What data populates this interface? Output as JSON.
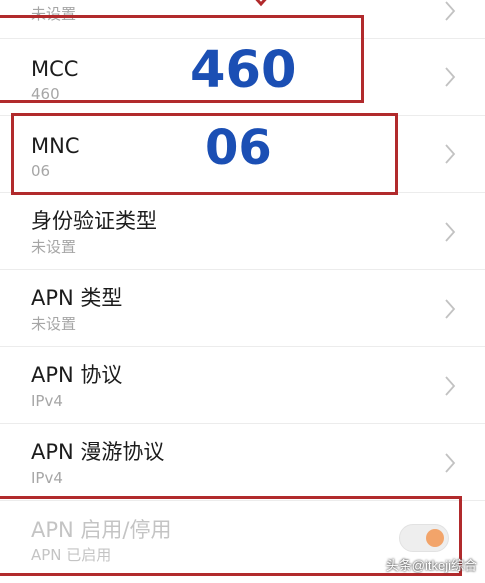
{
  "rows": [
    {
      "title": "",
      "subtitle": "未设置"
    },
    {
      "title": "MCC",
      "subtitle": "460"
    },
    {
      "title": "MNC",
      "subtitle": "06"
    },
    {
      "title": "身份验证类型",
      "subtitle": "未设置"
    },
    {
      "title": "APN 类型",
      "subtitle": "未设置"
    },
    {
      "title": "APN 协议",
      "subtitle": "IPv4"
    },
    {
      "title": "APN 漫游协议",
      "subtitle": "IPv4"
    },
    {
      "title": "APN 启用/停用",
      "subtitle": "APN 已启用"
    }
  ],
  "annotations": {
    "mcc_value": "460",
    "mnc_value": "06"
  },
  "toggle": {
    "apn_enabled": true
  },
  "icons": {
    "row_chevron": "chevron-right-icon",
    "top_arrow": "down-arrow-icon"
  },
  "colors": {
    "highlight_box": "#b12a2c",
    "annotation_text": "#1b4fb4",
    "toggle_knob": "#f2a46a"
  },
  "watermark": "头条@itkeji综合"
}
